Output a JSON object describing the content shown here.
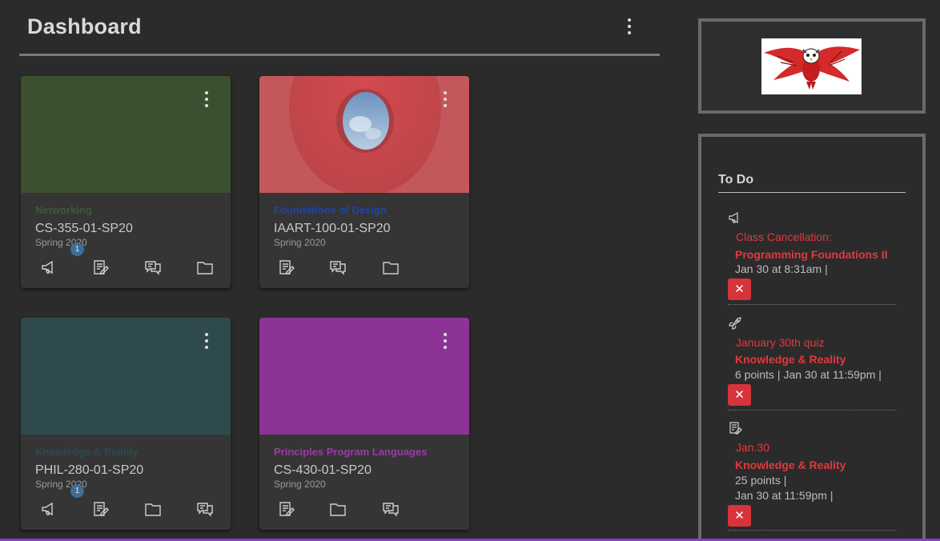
{
  "header": {
    "title": "Dashboard",
    "menu_icon": "kebab-icon"
  },
  "cards": [
    {
      "subtitle": "Networking",
      "code": "CS-355-01-SP20",
      "term": "Spring 2020",
      "color": "#3b4f31",
      "subtitle_color": "#3e5a34",
      "actions": [
        {
          "icon": "announcements-icon",
          "badge": "1"
        },
        {
          "icon": "assignments-icon"
        },
        {
          "icon": "discussions-icon"
        },
        {
          "icon": "files-icon"
        }
      ]
    },
    {
      "subtitle": "Foundations of Design",
      "code": "IAART-100-01-SP20",
      "term": "Spring 2020",
      "color": "#c2484c",
      "subtitle_color": "#1f44a6",
      "actions": [
        {
          "icon": "assignments-icon"
        },
        {
          "icon": "discussions-icon"
        },
        {
          "icon": "files-icon"
        }
      ]
    },
    {
      "subtitle": "Knowledge & Reality",
      "code": "PHIL-280-01-SP20",
      "term": "Spring 2020",
      "color": "#2f4a4f",
      "subtitle_color": "#2f4a4f",
      "actions": [
        {
          "icon": "announcements-icon",
          "badge": "1"
        },
        {
          "icon": "assignments-icon"
        },
        {
          "icon": "files-icon"
        },
        {
          "icon": "discussions-icon"
        }
      ]
    },
    {
      "subtitle": "Principles Program Languages",
      "code": "CS-430-01-SP20",
      "term": "Spring 2020",
      "color": "#8d3398",
      "subtitle_color": "#9a3aa6",
      "actions": [
        {
          "icon": "assignments-icon"
        },
        {
          "icon": "files-icon"
        },
        {
          "icon": "discussions-icon"
        }
      ]
    }
  ],
  "sidebar": {
    "logo": "red-owl-logo",
    "todo": {
      "title": "To Do",
      "items": [
        {
          "icon": "announcement-icon",
          "title": "Class Cancellation:",
          "course": "Programming Foundations II",
          "meta_lines": [
            "Jan 30 at 8:31am  |"
          ],
          "dismiss": "✕"
        },
        {
          "icon": "quiz-rocket-icon",
          "title": "January 30th quiz",
          "course": "Knowledge & Reality",
          "meta_lines": [
            "6 points  |  Jan 30 at 11:59pm  |"
          ],
          "dismiss": "✕"
        },
        {
          "icon": "assignment-icon",
          "title": "Jan.30",
          "course": "Knowledge & Reality",
          "meta_lines": [
            "25 points  |",
            "Jan 30 at 11:59pm  |"
          ],
          "dismiss": "✕"
        }
      ]
    }
  },
  "colors": {
    "background": "#2b2b2b",
    "accent_red": "#e0393e",
    "dismiss_red": "#d7333a",
    "bottom_bar": "#8a3cc9"
  }
}
